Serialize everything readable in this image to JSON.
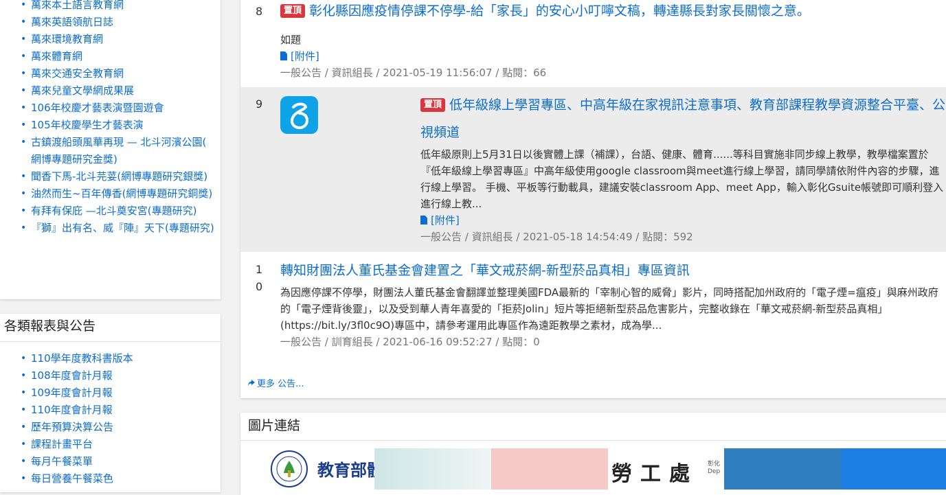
{
  "sidebar_links": [
    "萬來本土語言教育網",
    "萬來英語領航日誌",
    "萬來環境教育網",
    "萬來體育網",
    "萬來交通安全教育網",
    "萬來兒童文學網成果展",
    "106年校慶才藝表演暨園遊會",
    "105年校慶學生才藝表演",
    "古鎮渡船頭風華再現 — 北斗河濱公園( 網博專題研究金獎)",
    "聞香下馬-北斗芫荽(網博專題研究銀獎)",
    "油然而生~百年傳香(網博專題研究銅獎)",
    "有拜有保庇 —北斗奠安宮(專題研究)",
    "『獅』出有名、威『陣』天下(專題研究)"
  ],
  "reports": {
    "heading": "各類報表與公告",
    "items": [
      "110學年度教科書版本",
      "108年度會計月報",
      "109年度會計月報",
      "110年度會計月報",
      "歷年預算決算公告",
      "課程計畫平台",
      "每月午餐菜單",
      "每日營養午餐菜色"
    ]
  },
  "announcements": [
    {
      "num": "8",
      "badge": "置頂",
      "title": "彰化縣因應疫情停課不停學-給「家長」的安心小叮嚀文稿，轉達縣長對家長關懷之意。",
      "body": "如題",
      "attachment": "[附件]",
      "meta": "一般公告 / 資訊組長 / 2021-05-19 11:56:07 / 點閱：66"
    },
    {
      "num": "9",
      "badge": "置頂",
      "title": "低年級線上學習專區、中高年級在家視訊注意事項、教育部課程教學資源整合平臺、公視頻道",
      "body": "低年級原則上5月31日以後實體上課（補課），台語、健康、體育......等科目實施非同步線上教學，教學檔案置於『低年級線上學習專區』中高年級使用google classroom與meet進行線上學習，請同學請依附件內容的步驟，進行線上學習。 手機、平板等行動載具，建議安裝classroom App、meet App，輸入彰化Gsuite帳號即可順利登入進行線上教...",
      "attachment": "[附件]",
      "meta": "一般公告 / 資訊組長 / 2021-05-18 14:54:49 / 點閱：592"
    },
    {
      "num": "1\n0",
      "title": "轉知財團法人董氏基金會建置之「華文戒菸網-新型菸品真相」專區資訊",
      "body": "為因應停課不停學，財團法人董氏基金會翻譯並整理美國FDA最新的「宰制心智的威脅」影片，同時搭配加州政府的「電子煙=瘟疫」與麻州政府的「電子煙背後靈」，以及受到華人青年喜愛的「拒菸Jolin」短片等拒絕新型菸品危害影片，完整收錄在「華文戒菸網-新型菸品真相」(https://bit.ly/3fl0c9O)專區中，請參考運用此專區作為遠距教學之素材，成為學...",
      "meta": "一般公告 / 訓育組長 / 2021-06-16 09:52:27 / 點閱：0"
    }
  ],
  "more_link": "更多 公告...",
  "pictures": {
    "heading": "圖片連結",
    "moe_label": "教育部體",
    "labor_label": "勞工處",
    "labor_sub": "彰化\nDep"
  },
  "colors": {
    "link": "#0d6dcf",
    "badge": "#d9363e",
    "app_logo": "#0ea3e6"
  }
}
